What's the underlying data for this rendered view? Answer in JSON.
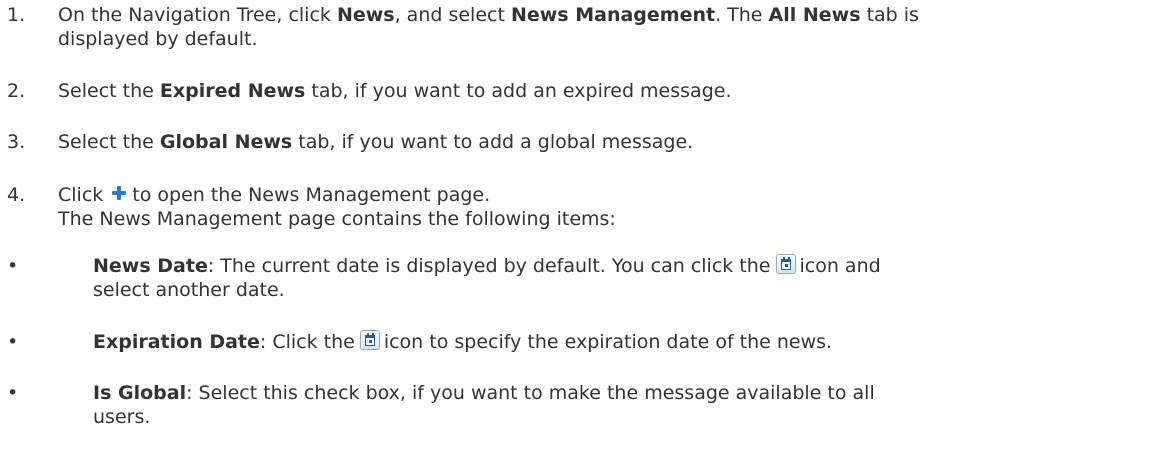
{
  "steps": [
    {
      "number": "1.",
      "parts": {
        "a": "On the Navigation Tree, click ",
        "b1": "News",
        "c": ", and select ",
        "b2": "News Management",
        "d": ". The ",
        "b3": "All News",
        "e": " tab is",
        "f": "displayed by default."
      }
    },
    {
      "number": "2.",
      "parts": {
        "a": "Select the ",
        "b1": "Expired News",
        "c": " tab, if you want to add an expired message."
      }
    },
    {
      "number": "3.",
      "parts": {
        "a": "Select the ",
        "b1": "Global News",
        "c": " tab, if you want to add a global message."
      }
    },
    {
      "number": "4.",
      "parts": {
        "a": "Click",
        "icon": "plus-icon",
        "c": "to open the News Management page.",
        "d": "The News Management page contains the following items:"
      },
      "items": [
        {
          "bullet": "•",
          "label": "News Date",
          "a": ": The current date is displayed by default. You can click the",
          "icon": "calendar-icon",
          "b": "icon and",
          "c": "select another date."
        },
        {
          "bullet": "•",
          "label": "Expiration Date",
          "a": ": Click the",
          "icon": "calendar-icon",
          "b": "icon to specify the expiration date of the news."
        },
        {
          "bullet": "•",
          "label": "Is Global",
          "a": ": Select this check box, if you want to make the message available to all",
          "b": "users."
        }
      ]
    }
  ],
  "colors": {
    "text": "#333333",
    "plus_icon": "#2a79d4",
    "calendar_icon": "#2d5d9c"
  }
}
